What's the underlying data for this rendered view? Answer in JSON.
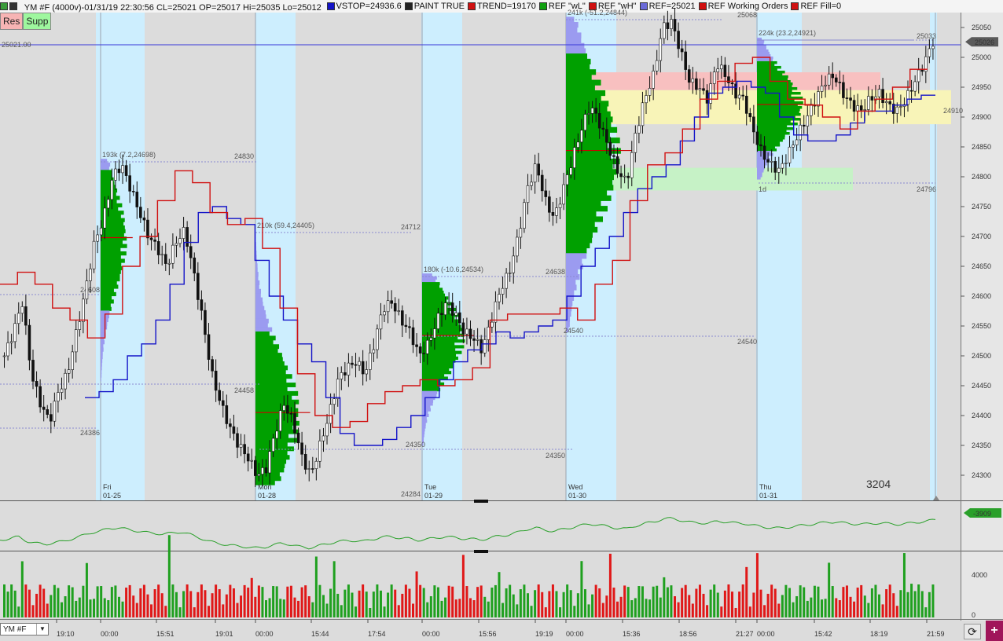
{
  "header": {
    "instrument_title": "YM #F (4000v)-01/31/19 22:30:56 CL=25021 OP=25017 Hi=25035 Lo=25012",
    "indicators": [
      {
        "label": "VSTOP=24936.6",
        "color": "#1414c8"
      },
      {
        "label": "PAINT TRUE",
        "color": "#222222"
      },
      {
        "label": "TREND=19170",
        "color": "#d01010"
      },
      {
        "label": "REF \"wL\"",
        "color": "#10a010"
      },
      {
        "label": "REF \"wH\"",
        "color": "#d01010"
      },
      {
        "label": "REF=25021",
        "color": "#6a6ad8"
      },
      {
        "label": "REF Working Orders",
        "color": "#d01010"
      },
      {
        "label": "REF Fill=0",
        "color": "#d01010"
      }
    ]
  },
  "toolbar": {
    "res_label": "Res",
    "supp_label": "Supp"
  },
  "price_axis": {
    "ticks": [
      "25050",
      "25000",
      "24950",
      "24900",
      "24850",
      "24800",
      "24750",
      "24700",
      "24650",
      "24600",
      "24550",
      "24500",
      "24450",
      "24400",
      "24350",
      "24300"
    ]
  },
  "current_price": {
    "label": "25026",
    "left_label": "25021.00"
  },
  "ref_levels": {
    "r24910": "24910",
    "vol_note": "3204",
    "oscillator_value": "-3909",
    "volume_ticks": [
      "4000",
      "0"
    ]
  },
  "sessions": [
    {
      "day": "Fri",
      "date": "01-25",
      "profile_header": "193k (7.2,24698)",
      "high": "24830",
      "level_mid": "24608",
      "level_low": "24458",
      "low": "24386"
    },
    {
      "day": "Mon",
      "date": "01-28",
      "profile_header": "210k (59.4,24405)",
      "high": "24712",
      "low": "24284",
      "level": "24350"
    },
    {
      "day": "Tue",
      "date": "01-29",
      "profile_header": "180k (-10.6,24534)",
      "high": "24638",
      "level_mid": "24540",
      "low": "24350"
    },
    {
      "day": "Wed",
      "date": "01-30",
      "profile_header": "241k (-51.2,24844)",
      "high": "25068",
      "low": "24540"
    },
    {
      "day": "Thu",
      "date": "01-31",
      "profile_header": "224k (23.2,24921)",
      "high": "25033",
      "low": "24796",
      "tag": "1d"
    }
  ],
  "time_axis": [
    "19:10",
    "00:00",
    "15:51",
    "19:01",
    "00:00",
    "15:44",
    "17:54",
    "00:00",
    "15:56",
    "19:19",
    "00:00",
    "15:36",
    "18:56",
    "21:27",
    "00:00",
    "15:42",
    "18:19",
    "21:59"
  ],
  "bottom": {
    "symbol": "YM #F"
  },
  "colors": {
    "bull": "#1a1a1a",
    "vstop": "#1414c8",
    "trend": "#d01010",
    "profile_up": "#00a000",
    "profile_dn": "#9b9bf0",
    "session_band": "#cdeefe"
  },
  "chart_data": {
    "type": "candlestick",
    "title": "YM #F (4000v)",
    "ylim": [
      24270,
      25080
    ],
    "price_ticks": [
      25050,
      25000,
      24950,
      24900,
      24850,
      24800,
      24750,
      24700,
      24650,
      24600,
      24550,
      24500,
      24450,
      24400,
      24350,
      24300
    ],
    "series": [
      {
        "name": "price_path",
        "values": [
          24500,
          24540,
          24590,
          24470,
          24420,
          24390,
          24440,
          24470,
          24540,
          24610,
          24690,
          24730,
          24800,
          24820,
          24780,
          24740,
          24700,
          24680,
          24650,
          24690,
          24710,
          24640,
          24560,
          24470,
          24420,
          24380,
          24350,
          24330,
          24300,
          24310,
          24370,
          24420,
          24390,
          24330,
          24300,
          24350,
          24400,
          24460,
          24480,
          24490,
          24470,
          24520,
          24580,
          24590,
          24560,
          24540,
          24500,
          24520,
          24560,
          24590,
          24570,
          24540,
          24530,
          24510,
          24560,
          24610,
          24640,
          24700,
          24780,
          24820,
          24760,
          24730,
          24780,
          24830,
          24880,
          24920,
          24890,
          24850,
          24810,
          24790,
          24870,
          24930,
          24970,
          25050,
          25060,
          25010,
          24960,
          24950,
          24930,
          24990,
          24970,
          24940,
          24930,
          24880,
          24840,
          24820,
          24810,
          24840,
          24870,
          24900,
          24930,
          24960,
          24970,
          24940,
          24920,
          24910,
          24930,
          24940,
          24920,
          24910,
          24930,
          24960,
          24990,
          25026
        ]
      }
    ],
    "vstop": [
      24430,
      24440,
      24460,
      24500,
      24520,
      24560,
      24620,
      24690,
      24740,
      24750,
      24730,
      24720,
      24660,
      24600,
      24560,
      24520,
      24490,
      24430,
      24370,
      24350,
      24350,
      24360,
      24380,
      24400,
      24430,
      24460,
      24490,
      24510,
      24520,
      24540,
      24530,
      24540,
      24550,
      24560,
      24600,
      24650,
      24680,
      24700,
      24740,
      24780,
      24800,
      24820,
      24860,
      24900,
      24940,
      24950,
      24960,
      24950,
      24940,
      24900,
      24870,
      24860,
      24860,
      24870,
      24890,
      24910,
      24910,
      24920,
      24930,
      24936.6
    ],
    "trend": [
      24620,
      24640,
      24620,
      24580,
      24560,
      24530,
      24570,
      24650,
      24700,
      24760,
      24810,
      24790,
      24740,
      24720,
      24730,
      24680,
      24580,
      24470,
      24400,
      24380,
      24390,
      24420,
      24440,
      24450,
      24460,
      24450,
      24460,
      24480,
      24560,
      24570,
      24570,
      24570,
      24580,
      24560,
      24620,
      24660,
      24760,
      24820,
      24840,
      24880,
      24930,
      24960,
      24990,
      25000,
      24960,
      24930,
      24920,
      24900,
      24880,
      24910,
      24930,
      24950,
      24980
    ]
  }
}
